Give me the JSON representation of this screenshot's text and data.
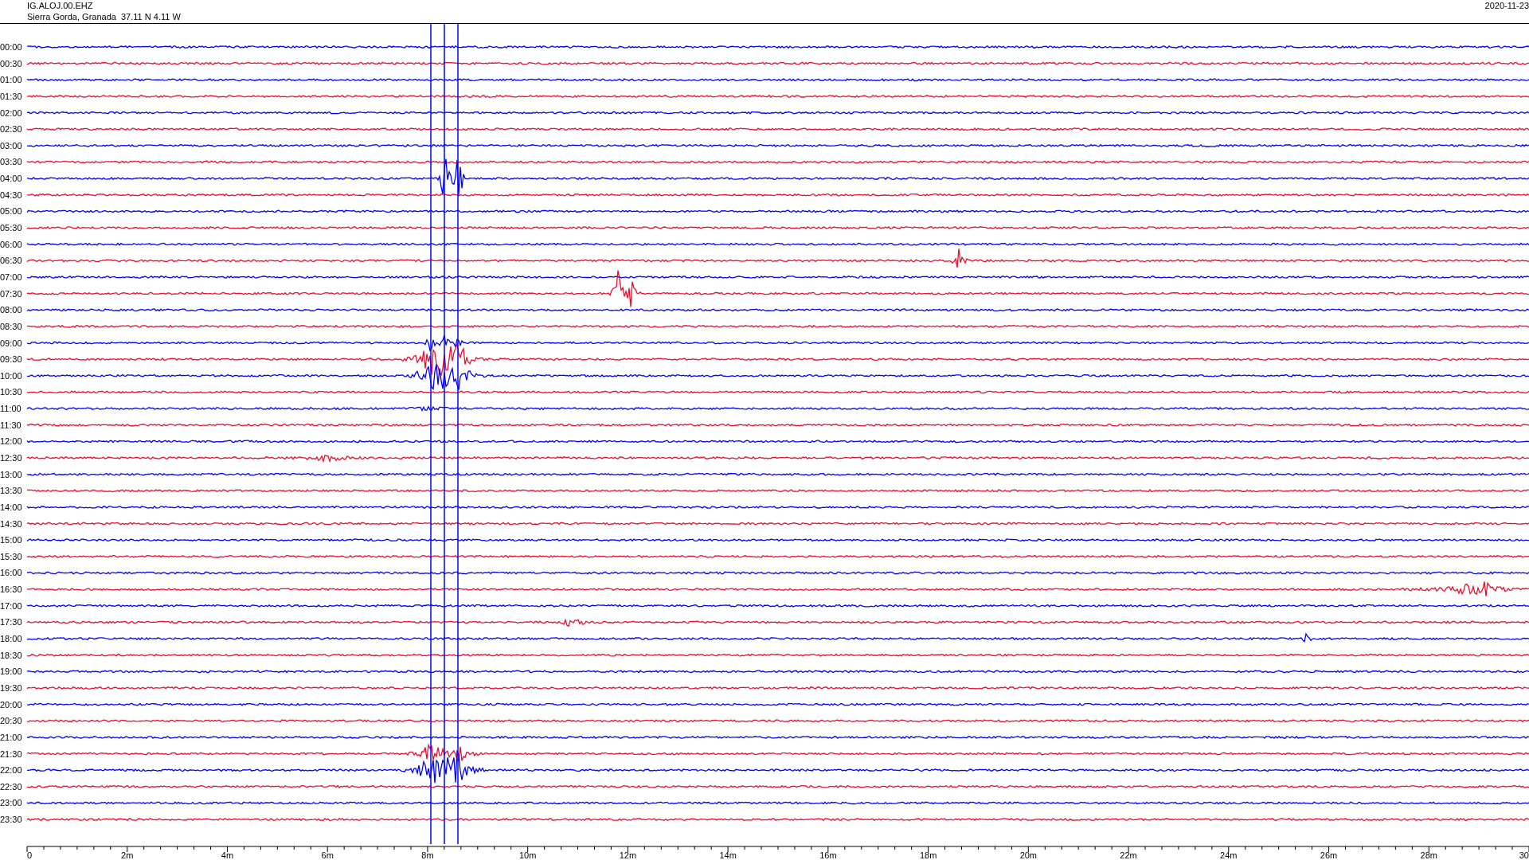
{
  "header": {
    "station": "IG.ALOJ.00.EHZ",
    "location": "Sierra Gorda, Granada  37.11 N 4.11 W",
    "date": "2020-11-23"
  },
  "rows": [
    {
      "time": "00:00",
      "color": "#0000ff"
    },
    {
      "time": "00:30",
      "color": "#e8102e"
    },
    {
      "time": "01:00",
      "color": "#0000ff"
    },
    {
      "time": "01:30",
      "color": "#e8102e"
    },
    {
      "time": "02:00",
      "color": "#0000ff"
    },
    {
      "time": "02:30",
      "color": "#e8102e"
    },
    {
      "time": "03:00",
      "color": "#0000ff"
    },
    {
      "time": "03:30",
      "color": "#e8102e"
    },
    {
      "time": "04:00",
      "color": "#0000ff"
    },
    {
      "time": "04:30",
      "color": "#e8102e"
    },
    {
      "time": "05:00",
      "color": "#0000ff"
    },
    {
      "time": "05:30",
      "color": "#e8102e"
    },
    {
      "time": "06:00",
      "color": "#0000ff"
    },
    {
      "time": "06:30",
      "color": "#e8102e"
    },
    {
      "time": "07:00",
      "color": "#0000ff"
    },
    {
      "time": "07:30",
      "color": "#e8102e"
    },
    {
      "time": "08:00",
      "color": "#0000ff"
    },
    {
      "time": "08:30",
      "color": "#e8102e"
    },
    {
      "time": "09:00",
      "color": "#0000ff"
    },
    {
      "time": "09:30",
      "color": "#e8102e"
    },
    {
      "time": "10:00",
      "color": "#0000ff"
    },
    {
      "time": "10:30",
      "color": "#e8102e"
    },
    {
      "time": "11:00",
      "color": "#0000ff"
    },
    {
      "time": "11:30",
      "color": "#e8102e"
    },
    {
      "time": "12:00",
      "color": "#0000ff"
    },
    {
      "time": "12:30",
      "color": "#e8102e"
    },
    {
      "time": "13:00",
      "color": "#0000ff"
    },
    {
      "time": "13:30",
      "color": "#e8102e"
    },
    {
      "time": "14:00",
      "color": "#0000ff"
    },
    {
      "time": "14:30",
      "color": "#e8102e"
    },
    {
      "time": "15:00",
      "color": "#0000ff"
    },
    {
      "time": "15:30",
      "color": "#e8102e"
    },
    {
      "time": "16:00",
      "color": "#0000ff"
    },
    {
      "time": "16:30",
      "color": "#e8102e"
    },
    {
      "time": "17:00",
      "color": "#0000ff"
    },
    {
      "time": "17:30",
      "color": "#e8102e"
    },
    {
      "time": "18:00",
      "color": "#0000ff"
    },
    {
      "time": "18:30",
      "color": "#e8102e"
    },
    {
      "time": "19:00",
      "color": "#0000ff"
    },
    {
      "time": "19:30",
      "color": "#e8102e"
    },
    {
      "time": "20:00",
      "color": "#0000ff"
    },
    {
      "time": "20:30",
      "color": "#e8102e"
    },
    {
      "time": "21:00",
      "color": "#0000ff"
    },
    {
      "time": "21:30",
      "color": "#e8102e"
    },
    {
      "time": "22:00",
      "color": "#0000ff"
    },
    {
      "time": "22:30",
      "color": "#e8102e"
    },
    {
      "time": "23:00",
      "color": "#0000ff"
    },
    {
      "time": "23:30",
      "color": "#e8102e"
    }
  ],
  "x_axis": {
    "labels": [
      "0",
      "2m",
      "4m",
      "6m",
      "8m",
      "10m",
      "12m",
      "14m",
      "16m",
      "18m",
      "20m",
      "22m",
      "24m",
      "26m",
      "28m",
      "30"
    ]
  }
}
